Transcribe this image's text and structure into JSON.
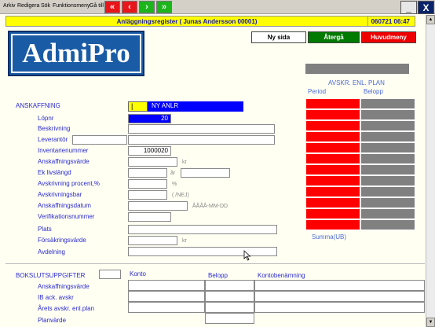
{
  "menu": [
    "Arkiv",
    "Redigera",
    "Sök",
    "Funktionsmeny",
    "Gå till"
  ],
  "nav": {
    "first": "«",
    "prev": "‹",
    "next": "›",
    "last": "»"
  },
  "window": {
    "minimize": "_",
    "close": "X"
  },
  "title": {
    "text": "Anläggningsregister ( Junas Andersson 00001)",
    "time": "060721 06:47"
  },
  "logo": "AdmiPro",
  "actions": {
    "new_page": "Ny sida",
    "back": "Återgå",
    "main_menu": "Huvudmeny"
  },
  "plan": {
    "heading": "AVSKR. ENL. PLAN",
    "col_period": "Period",
    "col_amount": "Belopp",
    "sum_label": "Summa(UB)",
    "rows": 12
  },
  "acquisition": {
    "section_label": "ANSKAFFNING",
    "code_value": "",
    "new_label": "NY ANLR",
    "fields": {
      "lopnr": {
        "label": "Löpnr",
        "value": "20"
      },
      "beskrivning": {
        "label": "Beskrivning",
        "value": ""
      },
      "leverantor": {
        "label": "Leverantör",
        "value": ""
      },
      "inventarienummer": {
        "label": "Inventarienummer",
        "value": "1000020"
      },
      "anskaffningsvarde": {
        "label": "Anskaffningsvärde",
        "value": "",
        "unit": "kr"
      },
      "ek_livslangd": {
        "label": "Ek livslängd",
        "value": "",
        "unit": "år"
      },
      "avskrivning_procent": {
        "label": "Avskrivning procent,%",
        "value": "",
        "unit": "%"
      },
      "avskrivningsbar": {
        "label": "Avskrivningsbar",
        "value": "",
        "unit": "( /NEJ)"
      },
      "anskaffningsdatum": {
        "label": "Anskaffningsdatum",
        "value": "",
        "hint": "ÅÅÅÅ-MM-DD"
      },
      "verifikationsnummer": {
        "label": "Verifikationsnummer",
        "value": ""
      },
      "plats": {
        "label": "Plats",
        "value": ""
      },
      "forsakringsvarde": {
        "label": "Försäkringsvärde",
        "value": "",
        "unit": "kr"
      },
      "avdelning": {
        "label": "Avdelning",
        "value": ""
      }
    }
  },
  "closing": {
    "section_label": "BOKSLUTSUPPGIFTER",
    "col_konto": "Konto",
    "col_belopp": "Belopp",
    "col_kontobenamning": "Kontobenämning",
    "rows": [
      "Anskaffningsvärde",
      "IB ack. avskr",
      "Årets avskr. enl.plan",
      "Planvärde"
    ]
  },
  "colors": {
    "accent_blue": "#0000ff",
    "plan_red": "#ff0000",
    "plan_gray": "#808080",
    "title_yellow": "#ffff00"
  }
}
